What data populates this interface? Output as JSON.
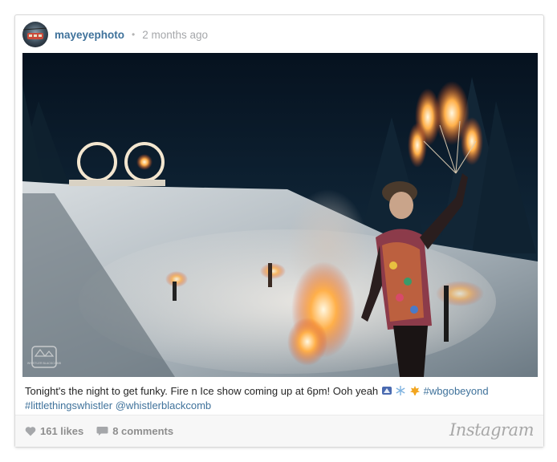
{
  "post": {
    "username": "mayeyephoto",
    "separator": "•",
    "time_ago": "2 months ago"
  },
  "caption": {
    "text": "Tonight's the night to get funky. Fire n Ice show coming up at 6pm! Ooh yeah ",
    "emojis": [
      "mountain-cablecar-emoji",
      "snowflake-emoji",
      "maple-leaf-emoji"
    ],
    "hashtag": "#wbgobeyond",
    "hashtag2": "#littlethingswhistler",
    "mention": "@whistlerblackcomb"
  },
  "footer": {
    "likes": "161 likes",
    "comments": "8 comments",
    "brand": "Instagram"
  },
  "watermark": {
    "logo_text": "WHISTLER BLACKCOMB"
  },
  "colors": {
    "link": "#3f729b",
    "muted": "#8e8e8e"
  },
  "icons": [
    "heart-icon",
    "comment-icon"
  ]
}
